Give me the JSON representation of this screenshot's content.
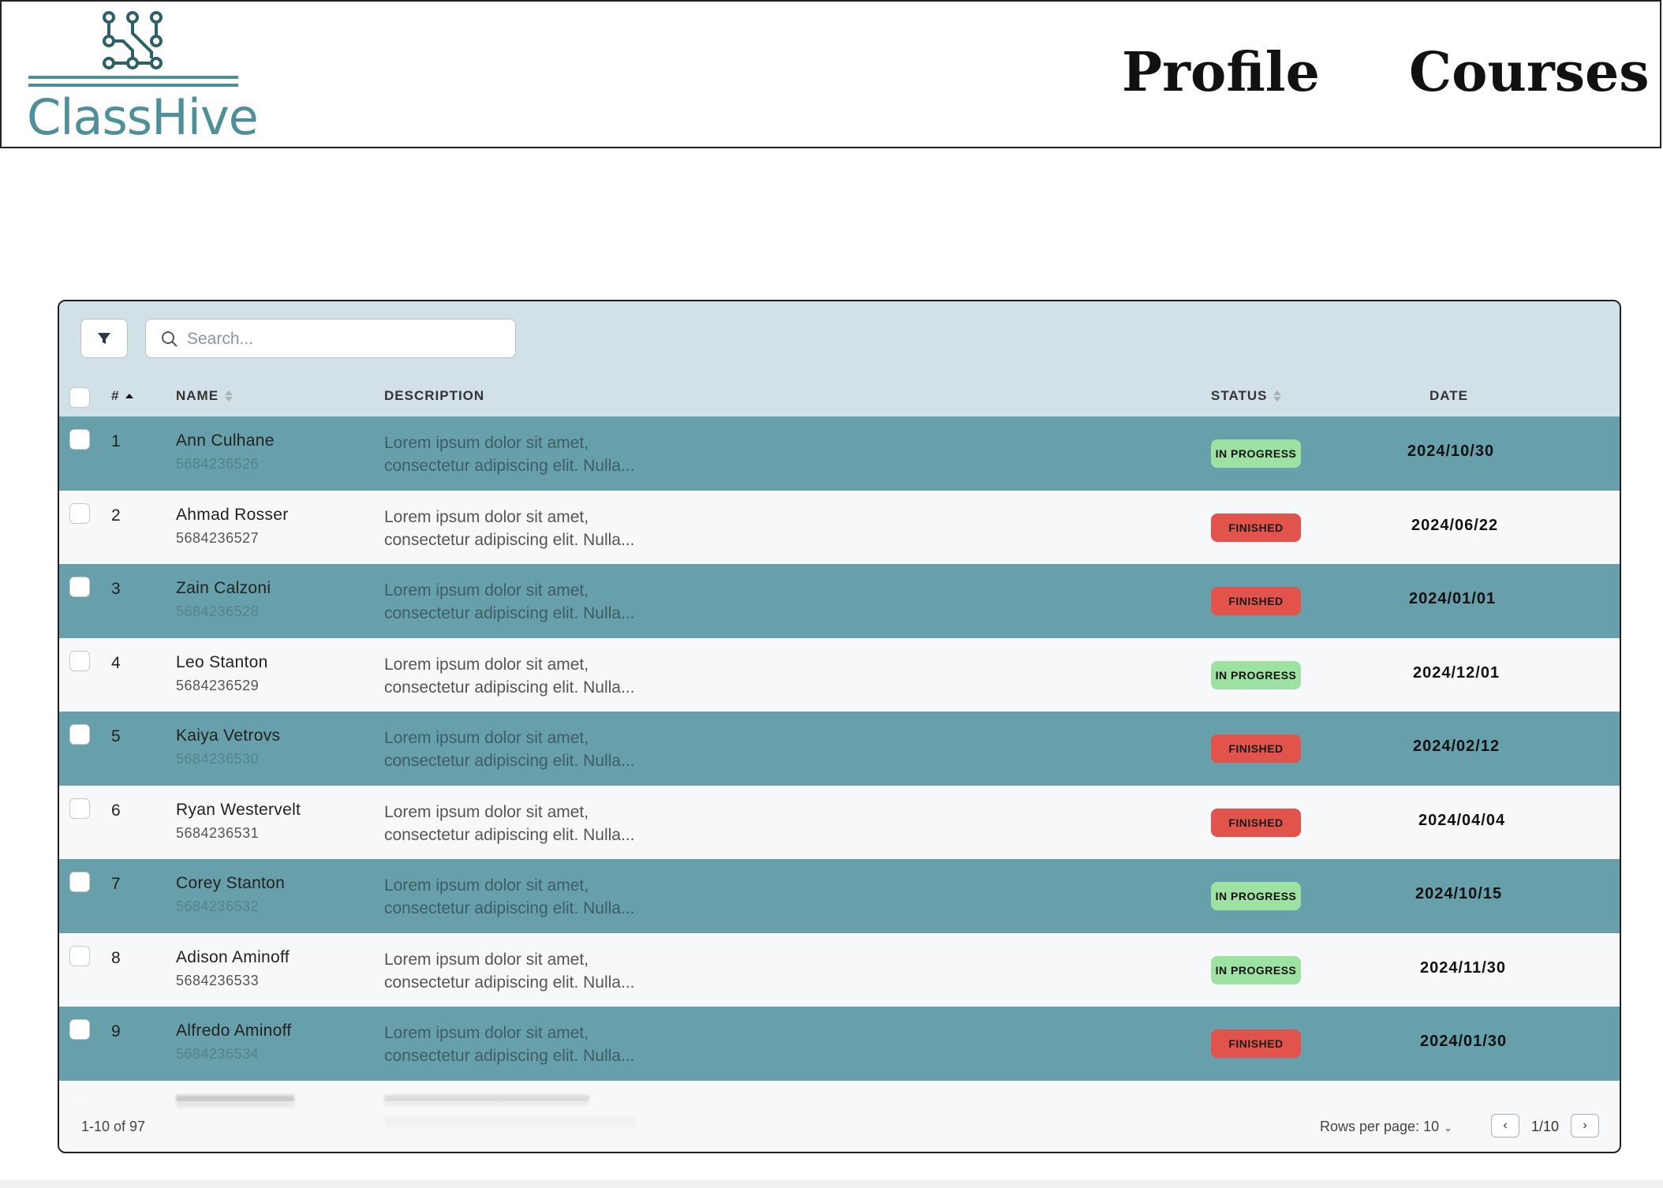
{
  "brand": {
    "name": "ClassHive",
    "logo_icon": "circuit-node-icon"
  },
  "nav": [
    {
      "label": "Profile"
    },
    {
      "label": "Courses"
    }
  ],
  "toolbar": {
    "filter_icon": "funnel-icon",
    "search": {
      "placeholder": "Search...",
      "value": "",
      "icon": "search-icon"
    }
  },
  "table": {
    "headers": {
      "num": "#",
      "name": "NAME",
      "description": "DESCRIPTION",
      "status": "STATUS",
      "date": "DATE"
    },
    "sort": {
      "column": "#",
      "direction": "ascending"
    },
    "rows": [
      {
        "num": "1",
        "name": "Ann Culhane",
        "id": "5684236526",
        "desc1": "Lorem ipsum dolor sit amet,",
        "desc2": "consectetur adipiscing elit. Nulla...",
        "status": "IN PROGRESS",
        "status_kind": "progress",
        "date": "2024/10/30"
      },
      {
        "num": "2",
        "name": "Ahmad Rosser",
        "id": "5684236527",
        "desc1": "Lorem ipsum dolor sit amet,",
        "desc2": "consectetur adipiscing elit. Nulla...",
        "status": "FINISHED",
        "status_kind": "finished",
        "date": "2024/06/22"
      },
      {
        "num": "3",
        "name": "Zain Calzoni",
        "id": "5684236528",
        "desc1": "Lorem ipsum dolor sit amet,",
        "desc2": "consectetur adipiscing elit. Nulla...",
        "status": "FINISHED",
        "status_kind": "finished",
        "date": "2024/01/01"
      },
      {
        "num": "4",
        "name": "Leo Stanton",
        "id": "5684236529",
        "desc1": "Lorem ipsum dolor sit amet,",
        "desc2": "consectetur adipiscing elit. Nulla...",
        "status": "IN PROGRESS",
        "status_kind": "progress",
        "date": "2024/12/01"
      },
      {
        "num": "5",
        "name": "Kaiya Vetrovs",
        "id": "5684236530",
        "desc1": "Lorem ipsum dolor sit amet,",
        "desc2": "consectetur adipiscing elit. Nulla...",
        "status": "FINISHED",
        "status_kind": "finished",
        "date": "2024/02/12"
      },
      {
        "num": "6",
        "name": "Ryan Westervelt",
        "id": "5684236531",
        "desc1": "Lorem ipsum dolor sit amet,",
        "desc2": "consectetur adipiscing elit. Nulla...",
        "status": "FINISHED",
        "status_kind": "finished",
        "date": "2024/04/04"
      },
      {
        "num": "7",
        "name": "Corey Stanton",
        "id": "5684236532",
        "desc1": "Lorem ipsum dolor sit amet,",
        "desc2": "consectetur adipiscing elit. Nulla...",
        "status": "IN PROGRESS",
        "status_kind": "progress",
        "date": "2024/10/15"
      },
      {
        "num": "8",
        "name": "Adison Aminoff",
        "id": "5684236533",
        "desc1": "Lorem ipsum dolor sit amet,",
        "desc2": "consectetur adipiscing elit. Nulla...",
        "status": "IN PROGRESS",
        "status_kind": "progress",
        "date": "2024/11/30"
      },
      {
        "num": "9",
        "name": "Alfredo Aminoff",
        "id": "5684236534",
        "desc1": "Lorem ipsum dolor sit amet,",
        "desc2": "consectetur adipiscing elit. Nulla...",
        "status": "FINISHED",
        "status_kind": "finished",
        "date": "2024/01/30"
      }
    ]
  },
  "footer": {
    "range": "1-10 of 97",
    "rows_per_page": "Rows per page: 10",
    "page": "1/10",
    "prev_icon": "chevron-left-icon",
    "next_icon": "chevron-right-icon"
  },
  "colors": {
    "brand": "#4f8f97",
    "row_highlight": "#67a0aa",
    "toolbar_bg": "#d2e0e7",
    "in_progress": "#9de2a2",
    "finished": "#e2534b"
  }
}
